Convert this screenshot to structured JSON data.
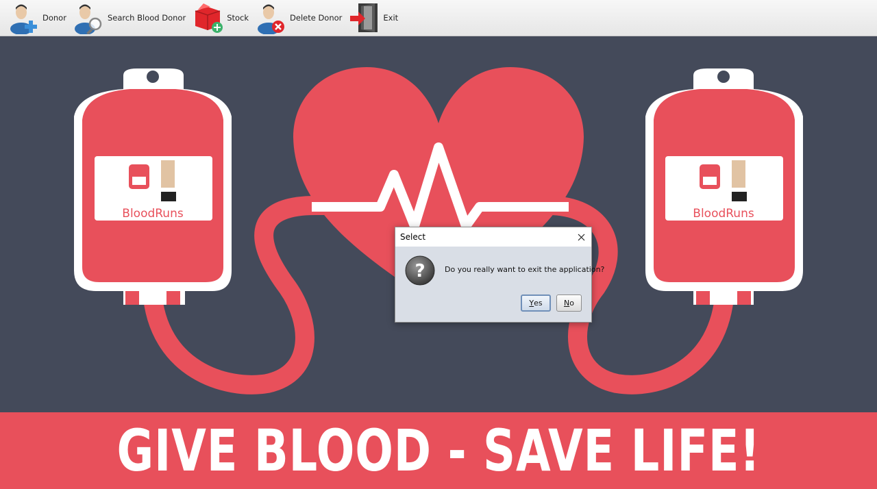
{
  "toolbar": {
    "items": [
      {
        "label": "Donor",
        "icon": "add-user-icon"
      },
      {
        "label": "Search Blood Donor",
        "icon": "search-user-icon"
      },
      {
        "label": "Stock",
        "icon": "add-box-icon"
      },
      {
        "label": "Delete Donor",
        "icon": "delete-user-icon"
      },
      {
        "label": "Exit",
        "icon": "exit-door-icon"
      }
    ]
  },
  "artwork": {
    "logo_text": "BloodRuns",
    "banner": "GIVE BLOOD - SAVE LIFE!"
  },
  "dialog": {
    "title": "Select",
    "message": "Do you really want to exit the application?",
    "yes_mnemonic": "Y",
    "yes_rest": "es",
    "no_mnemonic": "N",
    "no_rest": "o",
    "icon": "question-icon"
  },
  "colors": {
    "background": "#444a5a",
    "accent_red": "#e8505b",
    "toolbar_bg": "#ececec"
  }
}
